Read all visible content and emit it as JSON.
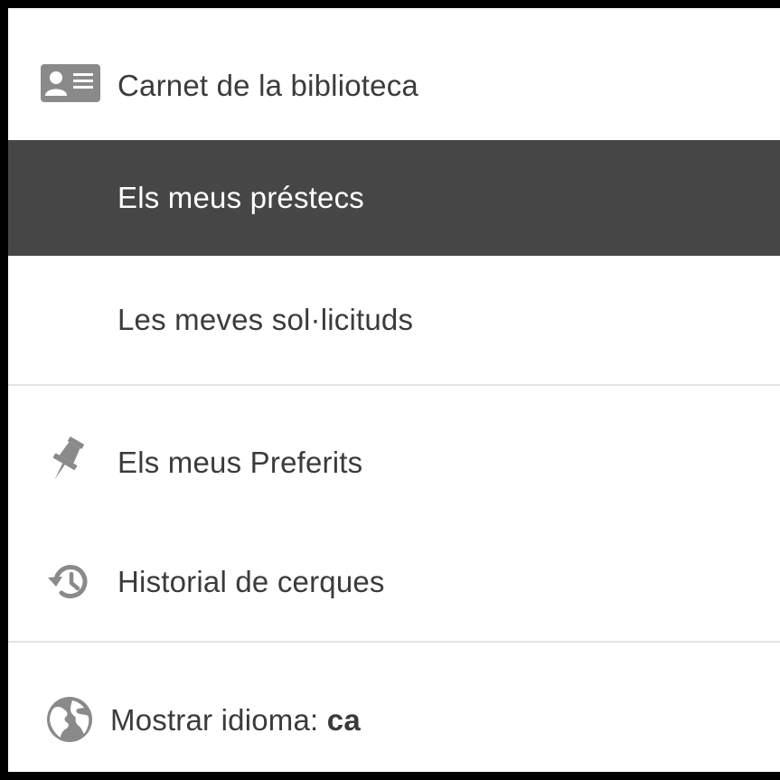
{
  "menu": {
    "library_card": {
      "label": "Carnet de la biblioteca",
      "icon": "id-card-icon"
    },
    "my_loans": {
      "label": "Els meus préstecs",
      "active": true
    },
    "my_requests": {
      "label": "Les meves sol·licituds"
    },
    "favorites": {
      "label": "Els meus Preferits",
      "icon": "pushpin-icon"
    },
    "search_history": {
      "label": "Historial de cerques",
      "icon": "history-icon"
    },
    "language": {
      "label": "Mostrar idioma:",
      "value": "ca",
      "icon": "globe-icon"
    }
  },
  "colors": {
    "active_bg": "#464646",
    "icon": "#8a8a8a",
    "text": "#3b3b3b",
    "divider": "#e4e4e4"
  }
}
